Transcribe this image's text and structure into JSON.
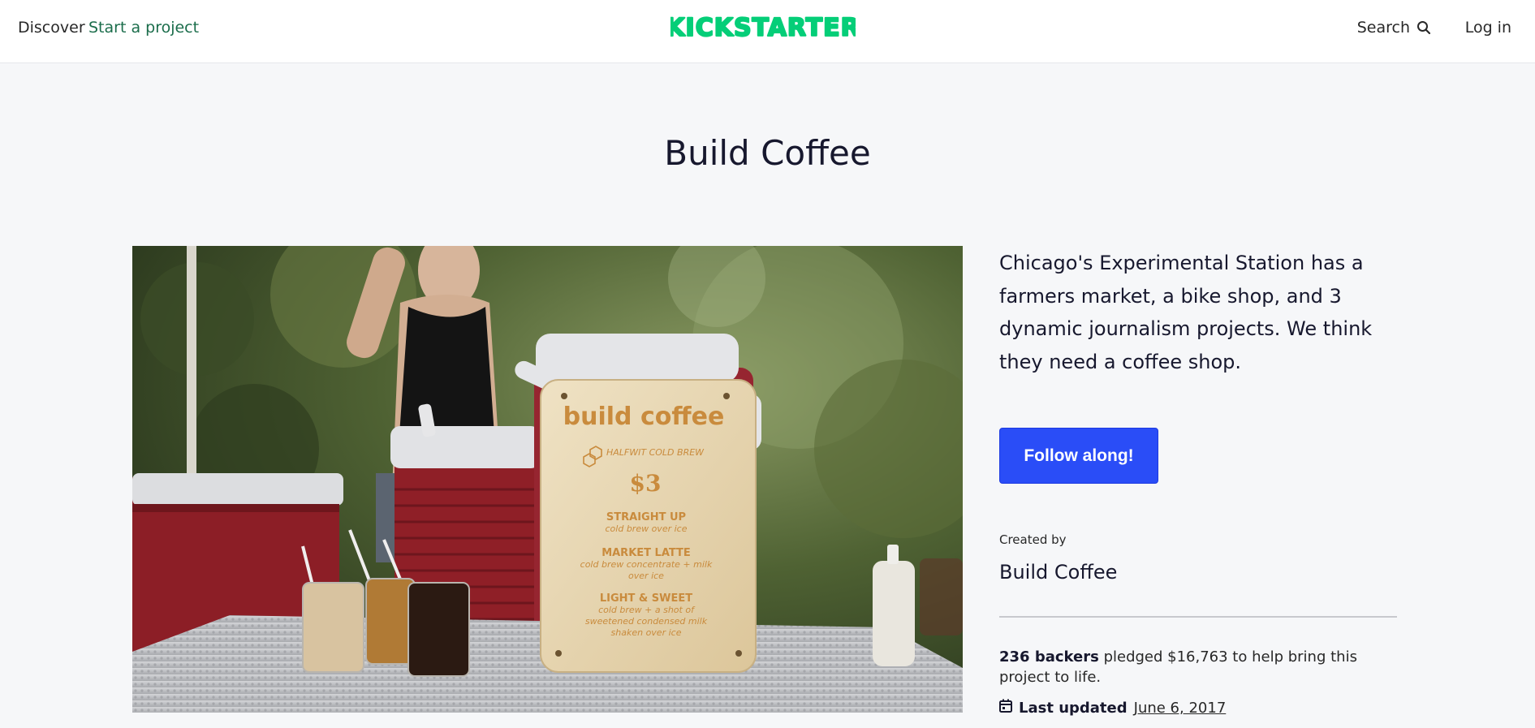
{
  "header": {
    "nav": {
      "discover": "Discover",
      "start_project": "Start a project",
      "search": "Search",
      "login": "Log in"
    },
    "logo_text": "KICKSTARTER",
    "logo_color": "#05ce78",
    "start_project_color": "#1b6d4b"
  },
  "project": {
    "title": "Build Coffee",
    "blurb": "Chicago's Experimental Station has a farmers market, a bike shop, and 3 dynamic journalism projects. We think they need a coffee shop.",
    "follow_label": "Follow along!",
    "follow_color": "#2a4df7",
    "created_by_label": "Created by",
    "creator_name": "Build Coffee",
    "backers": "236 backers",
    "pledged_text": "pledged $16,763 to help bring this project to life.",
    "last_updated_label": "Last updated",
    "last_updated_date": "June 6, 2017"
  },
  "hero_image": {
    "sign": {
      "headline": "build coffee",
      "brand": "HALFWIT COLD BREW",
      "price": "$3",
      "items": [
        {
          "name": "STRAIGHT UP",
          "desc": [
            "cold brew over ice"
          ]
        },
        {
          "name": "MARKET LATTE",
          "desc": [
            "cold brew concentrate + milk",
            "over ice"
          ]
        },
        {
          "name": "LIGHT & SWEET",
          "desc": [
            "cold brew + a shot of",
            "sweetened condensed milk",
            "shaken over ice"
          ]
        }
      ]
    }
  }
}
